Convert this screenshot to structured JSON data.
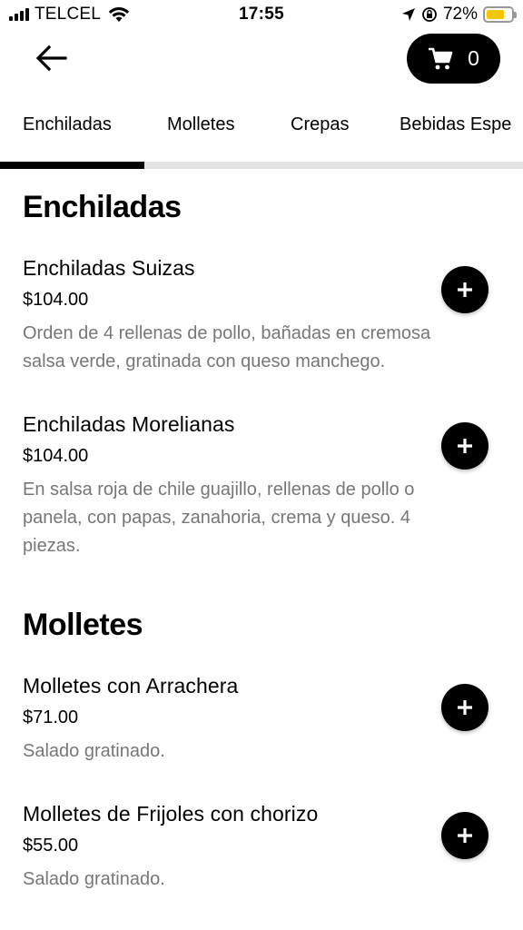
{
  "status_bar": {
    "carrier": "TELCEL",
    "time": "17:55",
    "battery_percent": "72%",
    "battery_color": "#f5c400",
    "battery_level": 0.72
  },
  "header": {
    "back_icon": "arrow-left-icon",
    "cart_icon": "cart-icon",
    "cart_count": "0"
  },
  "tabs": [
    {
      "label": "Enchiladas",
      "active": true
    },
    {
      "label": "Molletes",
      "active": false
    },
    {
      "label": "Crepas",
      "active": false
    },
    {
      "label": "Bebidas Espe",
      "active": false
    }
  ],
  "sections": [
    {
      "title": "Enchiladas",
      "items": [
        {
          "name": "Enchiladas Suizas",
          "price": "$104.00",
          "description": "Orden de 4 rellenas de pollo, bañadas en cremosa salsa verde, gratinada con queso manchego."
        },
        {
          "name": "Enchiladas Morelianas",
          "price": "$104.00",
          "description": "En salsa roja de chile guajillo, rellenas de pollo o panela, con papas, zanahoria, crema y queso. 4 piezas."
        }
      ]
    },
    {
      "title": "Molletes",
      "items": [
        {
          "name": "Molletes con Arrachera",
          "price": "$71.00",
          "description": "Salado gratinado."
        },
        {
          "name": "Molletes de Frijoles con chorizo",
          "price": "$55.00",
          "description": "Salado gratinado."
        }
      ]
    }
  ]
}
